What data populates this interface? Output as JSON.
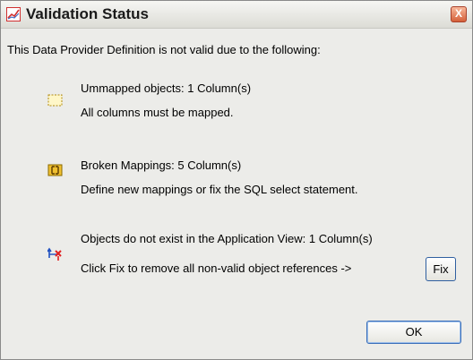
{
  "window": {
    "title": "Validation Status",
    "close_label": "X",
    "icon": "chart-line-icon"
  },
  "intro": "This Data Provider Definition is not valid due to the following:",
  "issues": [
    {
      "icon": "unmapped-objects-icon",
      "heading": "Ummapped objects: 1 Column(s)",
      "detail": "All columns must be mapped."
    },
    {
      "icon": "broken-mapping-icon",
      "heading": "Broken Mappings: 5 Column(s)",
      "detail": "Define new mappings or fix the SQL select statement."
    },
    {
      "icon": "missing-objects-icon",
      "heading": "Objects do not exist in the Application View: 1 Column(s)",
      "detail": "Click Fix to remove all non-valid object references ->"
    }
  ],
  "buttons": {
    "fix": "Fix",
    "ok": "OK"
  },
  "colors": {
    "dialog_bg": "#ecece9",
    "accent": "#3a6eb8",
    "close": "#d4603a"
  }
}
